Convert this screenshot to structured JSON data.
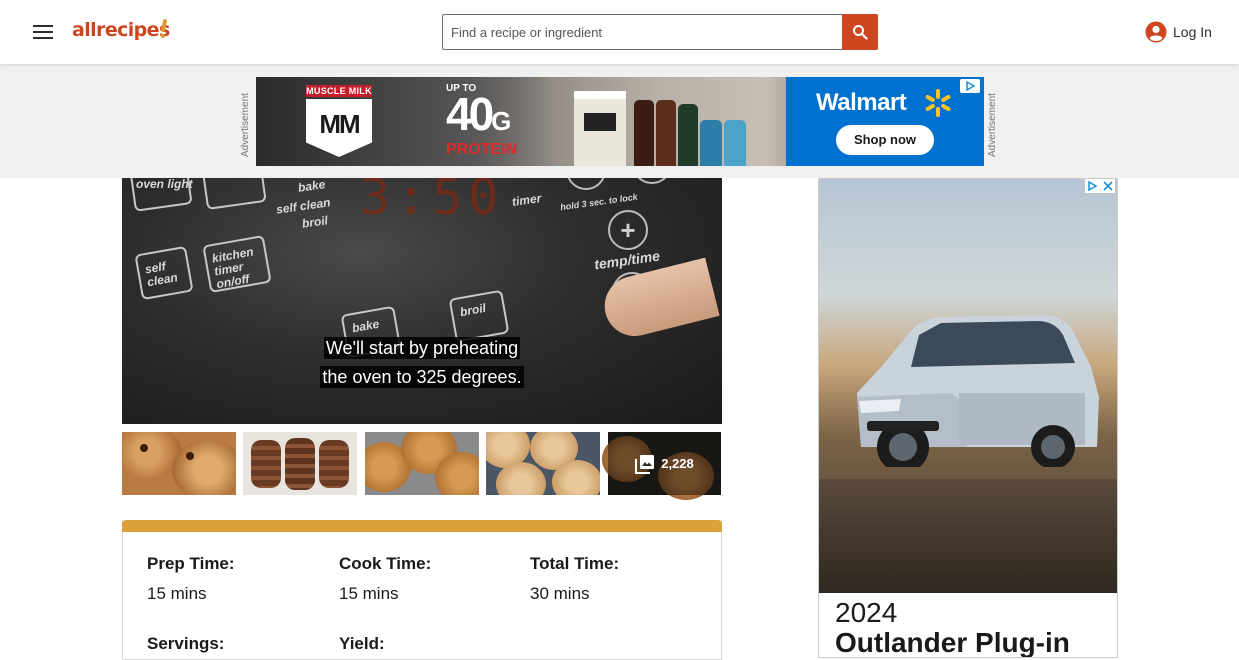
{
  "header": {
    "menu_icon": "hamburger-menu-icon",
    "logo_text": "allrecipes",
    "search": {
      "placeholder": "Find a recipe or ingredient",
      "value": ""
    },
    "login_label": "Log In",
    "brand_color": "#ce4620"
  },
  "top_ad": {
    "label": "Advertisement",
    "brand": "MUSCLE MILK",
    "logo_text": "MM",
    "upto": "UP TO",
    "headline": "40",
    "headline_unit": "G",
    "subline": "PROTEIN",
    "retailer": "Walmart",
    "cta": "Shop now"
  },
  "video": {
    "caption_line1": "We'll start by preheating",
    "caption_line2": "the oven to 325 degrees.",
    "oven_labels": {
      "oven_light": "oven light",
      "bake": "bake",
      "self_clean": "self clean",
      "broil": "broil",
      "timer": "timer",
      "hold": "hold 3 sec. to lock",
      "temp_time": "temp/time",
      "self_clean_btn": "self clean",
      "kitchen_timer": "kitchen timer on/off",
      "bake_btn": "bake",
      "broil_btn": "broil"
    }
  },
  "gallery": {
    "photo_count": "2,228",
    "thumbnails": [
      "cookie-photo-1",
      "cookie-photo-2",
      "cookie-photo-3",
      "cookie-photo-4"
    ]
  },
  "recipe_details": {
    "accent_color": "#d9a23a",
    "items": [
      {
        "label": "Prep Time:",
        "value": "15 mins"
      },
      {
        "label": "Cook Time:",
        "value": "15 mins"
      },
      {
        "label": "Total Time:",
        "value": "30 mins"
      },
      {
        "label": "Servings:",
        "value": ""
      },
      {
        "label": "Yield:",
        "value": ""
      }
    ]
  },
  "side_ad": {
    "year": "2024",
    "model": "Outlander Plug-in"
  }
}
